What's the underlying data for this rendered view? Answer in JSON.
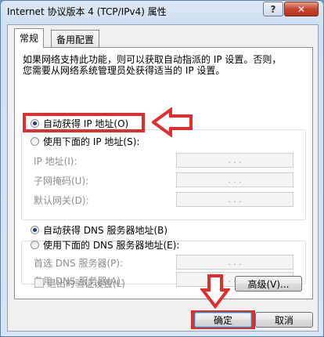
{
  "window": {
    "title": "Internet 协议版本 4 (TCP/IPv4) 属性",
    "help_label": "?",
    "close_label": "✕"
  },
  "tabs": [
    {
      "label": "常规",
      "active": true
    },
    {
      "label": "备用配置",
      "active": false
    }
  ],
  "description": "如果网络支持此功能，则可以获取自动指派的 IP 设置。否则，\n您需要从网络系统管理员处获得适当的 IP 设置。",
  "ip_section": {
    "auto_label": "自动获得 IP 地址(O)",
    "auto_selected": true,
    "manual_label": "使用下面的 IP 地址(S):",
    "fields": [
      {
        "label": "IP 地址(I):",
        "value": ". . ."
      },
      {
        "label": "子网掩码(U):",
        "value": ". . ."
      },
      {
        "label": "默认网关(D):",
        "value": ". . ."
      }
    ]
  },
  "dns_section": {
    "auto_label": "自动获得 DNS 服务器地址(B)",
    "auto_selected": true,
    "manual_label": "使用下面的 DNS 服务器地址(E):",
    "fields": [
      {
        "label": "首选 DNS 服务器(P):",
        "value": ". . ."
      },
      {
        "label": "备用 DNS 服务器(A):",
        "value": ". . ."
      }
    ]
  },
  "validate_label": "退出时验证设置(L)",
  "validate_checked": false,
  "advanced_label": "高级(V)...",
  "ok_label": "确定",
  "cancel_label": "取消",
  "annotation_color": "#e02d2d"
}
